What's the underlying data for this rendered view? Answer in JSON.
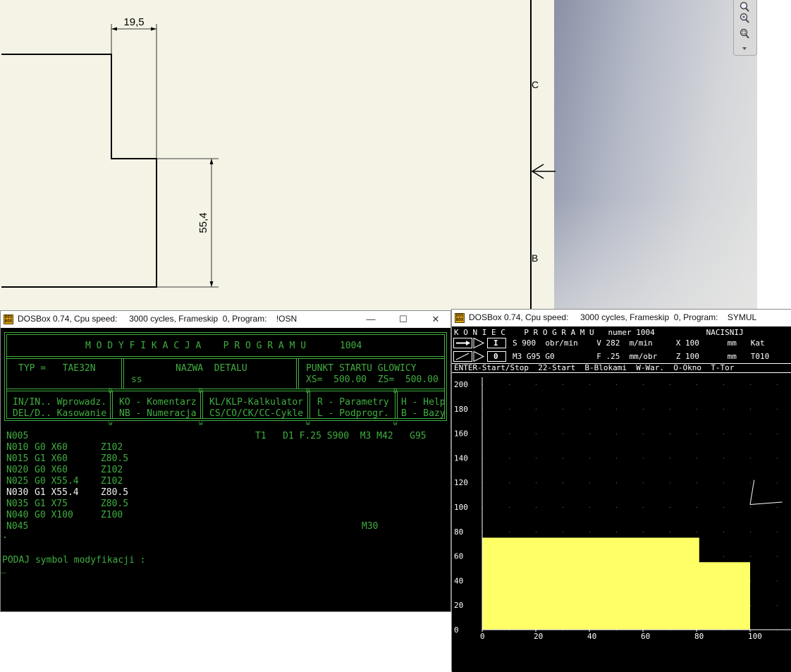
{
  "cad": {
    "dim_top": "19,5",
    "dim_side": "55,4",
    "label_c": "C",
    "label_b": "B"
  },
  "osn_window": {
    "title": "DOSBox 0.74, Cpu speed:     3000 cycles, Frameskip  0, Program:    !OSN",
    "header_title": "M O D Y F I K A C J A    P R O G R A M U",
    "program_number": "1004",
    "typ_label": "TYP =   TAE32N",
    "nazwa_label": "NAZWA  DETALU",
    "nazwa_value": "ss",
    "punkt_label": "PUNKT STARTU GLOWICY",
    "punkt_values": "XS=  500.00  ZS=  500.00",
    "menu": [
      {
        "line1": "IN/IN.. Wprowadz.",
        "line2": "DEL/D.. Kasowanie"
      },
      {
        "line1": "KO - Komentarz",
        "line2": "NB - Numeracja"
      },
      {
        "line1": "KL/KLP-Kalkulator",
        "line2": "CS/CO/CK/CC-Cykle"
      },
      {
        "line1": "R - Parametry",
        "line2": "L - Podprogr."
      },
      {
        "line1": "H - Help",
        "line2": "B - Bazy"
      }
    ],
    "program_lines": [
      {
        "n": "N005",
        "main": "",
        "extra": "T1   D1 F.25 S900  M3 M42   G95",
        "highlight": false
      },
      {
        "n": "N010",
        "main": "G0 X60      Z102",
        "extra": "",
        "highlight": false
      },
      {
        "n": "N015",
        "main": "G1 X60      Z80.5",
        "extra": "",
        "highlight": false
      },
      {
        "n": "N020",
        "main": "G0 X60      Z102",
        "extra": "",
        "highlight": false
      },
      {
        "n": "N025",
        "main": "G0 X55.4    Z102",
        "extra": "",
        "highlight": false
      },
      {
        "n": "N030",
        "main": "G1 X55.4    Z80.5",
        "extra": "",
        "highlight": true
      },
      {
        "n": "N035",
        "main": "G1 X75      Z80.5",
        "extra": "",
        "highlight": false
      },
      {
        "n": "N040",
        "main": "G0 X100     Z100",
        "extra": "",
        "highlight": false
      },
      {
        "n": "N045",
        "main": "",
        "extra": "M30",
        "highlight": false
      }
    ],
    "dot": ".",
    "prompt": "PODAJ symbol modyfikacji :",
    "cursor": "_"
  },
  "symul_window": {
    "title": "DOSBox 0.74, Cpu speed:     3000 cycles, Frameskip  0, Program:    SYMUL",
    "status_line": "K O N I E C    P R O G R A M U   numer 1004           NACISNIJ",
    "row1_mode": "I",
    "row1_text": "S 900  obr/min    V 282  m/min     X 100      mm   Kat",
    "row2_mode": "0",
    "row2_text": "M3 G95 G0         F .25  mm/obr    Z 100      mm   T010",
    "keys_line": "ENTER-Start/Stop  22-Start  B-Blokami  W-War.  O-Okno  T-Tor",
    "colors": {
      "material": "#ffff66",
      "background": "#000000",
      "text": "#ffffff"
    }
  },
  "chart_data": {
    "type": "area",
    "y_ticks": [
      "200",
      "180",
      "160",
      "140",
      "120",
      "100",
      "80",
      "60",
      "40",
      "20",
      "0"
    ],
    "x_ticks": [
      "0",
      "20",
      "40",
      "60",
      "80",
      "100"
    ],
    "xlim": [
      0,
      100
    ],
    "ylim": [
      0,
      200
    ],
    "material_profile": [
      [
        0,
        75
      ],
      [
        81,
        75
      ],
      [
        81,
        55
      ],
      [
        100,
        55
      ]
    ],
    "tool_lines": [
      [
        [
          100,
          102
        ],
        [
          101.5,
          122
        ]
      ],
      [
        [
          100,
          102
        ],
        [
          112,
          104
        ]
      ]
    ]
  }
}
